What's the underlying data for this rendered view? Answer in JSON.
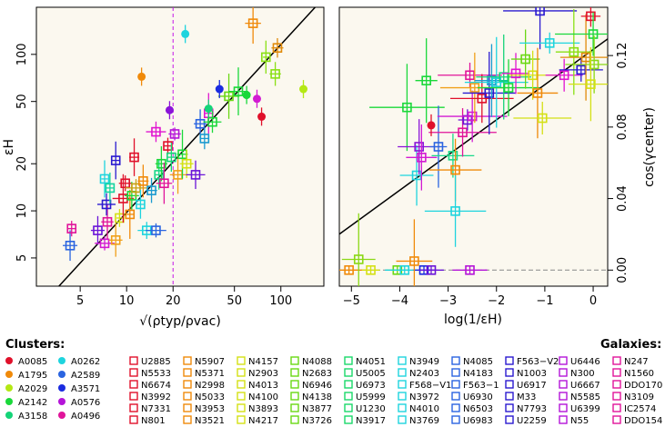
{
  "chart_data": [
    {
      "type": "scatter",
      "log_x": true,
      "log_y": true,
      "xlim": [
        2.6,
        190
      ],
      "ylim": [
        3.3,
        200
      ],
      "xlabel": "√(ρtyp/ρvac)",
      "ylabel": "εH",
      "x_ticks": [
        5,
        10,
        20,
        50,
        100
      ],
      "y_ticks": [
        5,
        10,
        20,
        50,
        100
      ],
      "fit_line": [
        [
          2.6,
          2.3
        ],
        [
          190,
          230
        ]
      ],
      "vline_x": 20,
      "cluster_points": [
        {
          "x": 12.5,
          "y": 72,
          "c": "#f08a0a"
        },
        {
          "x": 24,
          "y": 135,
          "c": "#1ed4de"
        },
        {
          "x": 40,
          "y": 60,
          "c": "#1a2be0"
        },
        {
          "x": 60,
          "y": 55,
          "c": "#1ad83a"
        },
        {
          "x": 70,
          "y": 52,
          "c": "#d21ad2"
        },
        {
          "x": 75,
          "y": 40,
          "c": "#e0102a"
        },
        {
          "x": 140,
          "y": 60,
          "c": "#b4e814"
        },
        {
          "x": 34,
          "y": 45,
          "c": "#14d478"
        },
        {
          "x": 19,
          "y": 44,
          "c": "#8a14d8"
        }
      ],
      "galaxy_points": [
        {
          "x": 4.3,
          "y": 6.0,
          "c": "#2a64e0"
        },
        {
          "x": 4.4,
          "y": 7.7,
          "c": "#e0149a"
        },
        {
          "x": 6.5,
          "y": 7.5,
          "c": "#6a14d8"
        },
        {
          "x": 7.2,
          "y": 6.2,
          "c": "#d21ad2"
        },
        {
          "x": 7.5,
          "y": 8.5,
          "c": "#e0149a"
        },
        {
          "x": 7.4,
          "y": 11,
          "c": "#2a1ad0"
        },
        {
          "x": 7.2,
          "y": 16,
          "c": "#1ed4de"
        },
        {
          "x": 7.8,
          "y": 14,
          "c": "#14d4a0"
        },
        {
          "x": 8.5,
          "y": 21,
          "c": "#2a1ad0"
        },
        {
          "x": 8.5,
          "y": 6.5,
          "c": "#f0a01a"
        },
        {
          "x": 9,
          "y": 9,
          "c": "#d4e014"
        },
        {
          "x": 9.5,
          "y": 12,
          "c": "#e0102a"
        },
        {
          "x": 9.8,
          "y": 15,
          "c": "#e0102a"
        },
        {
          "x": 10.5,
          "y": 9.5,
          "c": "#f08a0a"
        },
        {
          "x": 10.8,
          "y": 12.5,
          "c": "#1ad83a"
        },
        {
          "x": 11.2,
          "y": 22,
          "c": "#e0102a"
        },
        {
          "x": 11.5,
          "y": 14,
          "c": "#c8a014"
        },
        {
          "x": 12.3,
          "y": 11,
          "c": "#1ed4de"
        },
        {
          "x": 12.8,
          "y": 15.5,
          "c": "#f08a0a"
        },
        {
          "x": 13.5,
          "y": 7.5,
          "c": "#1ed4de"
        },
        {
          "x": 14.5,
          "y": 13.5,
          "c": "#1a9ad0"
        },
        {
          "x": 15.5,
          "y": 7.5,
          "c": "#2a64e0"
        },
        {
          "x": 15.5,
          "y": 32,
          "c": "#e014d0"
        },
        {
          "x": 16.2,
          "y": 17,
          "c": "#1ad88a"
        },
        {
          "x": 16.8,
          "y": 20,
          "c": "#1ad83a"
        },
        {
          "x": 17.5,
          "y": 15,
          "c": "#e0149a"
        },
        {
          "x": 18.5,
          "y": 26,
          "c": "#e0102a"
        },
        {
          "x": 19.5,
          "y": 22,
          "c": "#14d478"
        },
        {
          "x": 20.5,
          "y": 31,
          "c": "#b414d8"
        },
        {
          "x": 21.5,
          "y": 17,
          "c": "#f0a01a"
        },
        {
          "x": 23,
          "y": 23,
          "c": "#1ad83a"
        },
        {
          "x": 24.5,
          "y": 20,
          "c": "#d4e014"
        },
        {
          "x": 28,
          "y": 17,
          "c": "#6a14d8"
        },
        {
          "x": 30,
          "y": 36,
          "c": "#2a64e0"
        },
        {
          "x": 32,
          "y": 29,
          "c": "#1a9ad0"
        },
        {
          "x": 34,
          "y": 42,
          "c": "#e014d0"
        },
        {
          "x": 36,
          "y": 37,
          "c": "#1ad83a"
        },
        {
          "x": 46,
          "y": 54,
          "c": "#6ad814"
        },
        {
          "x": 53,
          "y": 58,
          "c": "#1ad83a"
        },
        {
          "x": 66,
          "y": 158,
          "c": "#f08a0a"
        },
        {
          "x": 80,
          "y": 96,
          "c": "#8ae014"
        },
        {
          "x": 92,
          "y": 75,
          "c": "#8ae014"
        },
        {
          "x": 95,
          "y": 110,
          "c": "#e08a0a"
        }
      ]
    },
    {
      "type": "scatter",
      "xlim": [
        -5.25,
        0.3
      ],
      "ylim": [
        -0.009,
        0.147
      ],
      "xlabel": "log(1/εH)",
      "ylabel": "cos(γcenter)",
      "x_ticks": [
        -5,
        -4,
        -3,
        -2,
        -1,
        0
      ],
      "x_ticklabels": [
        "−5",
        "−4",
        "−3",
        "−2",
        "−1",
        "0"
      ],
      "y_ticks": [
        0,
        0.04,
        0.08,
        0.12
      ],
      "y_ticklabels": [
        "0.00",
        "0.04",
        "0.08",
        "0.12"
      ],
      "fit_line": [
        [
          -5.25,
          0.0201
        ],
        [
          0.3,
          0.1293
        ]
      ],
      "zero_dashed": true,
      "cluster_points": [
        {
          "x": -3.35,
          "y": 0.081,
          "c": "#e0102a"
        }
      ],
      "galaxy_points": [
        {
          "x": -5.05,
          "y": 0.0,
          "c": "#f08a0a"
        },
        {
          "x": -4.85,
          "y": 0.006,
          "c": "#8ad814"
        },
        {
          "x": -4.6,
          "y": 0.0,
          "c": "#d4e014"
        },
        {
          "x": -4.05,
          "y": 0.0,
          "c": "#6ad814"
        },
        {
          "x": -3.9,
          "y": 0.0,
          "c": "#1ed4de"
        },
        {
          "x": -3.5,
          "y": 0.0,
          "c": "#1a2be0"
        },
        {
          "x": -3.35,
          "y": 0.0,
          "c": "#6a14d8"
        },
        {
          "x": -3.7,
          "y": 0.005,
          "c": "#f08a0a"
        },
        {
          "x": -2.55,
          "y": 0.0,
          "c": "#b414d8"
        },
        {
          "x": -3.85,
          "y": 0.091,
          "c": "#1ad83a"
        },
        {
          "x": -3.65,
          "y": 0.053,
          "c": "#1ed4de"
        },
        {
          "x": -3.6,
          "y": 0.069,
          "c": "#8a14d8"
        },
        {
          "x": -3.55,
          "y": 0.063,
          "c": "#d21ad2"
        },
        {
          "x": -3.45,
          "y": 0.106,
          "c": "#1ad83a"
        },
        {
          "x": -3.2,
          "y": 0.069,
          "c": "#2a64e0"
        },
        {
          "x": -2.9,
          "y": 0.064,
          "c": "#1ad88a"
        },
        {
          "x": -2.85,
          "y": 0.056,
          "c": "#f08a0a"
        },
        {
          "x": -2.85,
          "y": 0.033,
          "c": "#1ed4de"
        },
        {
          "x": -2.7,
          "y": 0.077,
          "c": "#e0149a"
        },
        {
          "x": -2.6,
          "y": 0.084,
          "c": "#6a14d8"
        },
        {
          "x": -2.5,
          "y": 0.086,
          "c": "#d21ad2"
        },
        {
          "x": -2.55,
          "y": 0.109,
          "c": "#e0149a"
        },
        {
          "x": -2.45,
          "y": 0.102,
          "c": "#f0a01a"
        },
        {
          "x": -2.3,
          "y": 0.096,
          "c": "#e0102a"
        },
        {
          "x": -2.15,
          "y": 0.099,
          "c": "#2a1ad0"
        },
        {
          "x": -2.1,
          "y": 0.106,
          "c": "#1a9ad0"
        },
        {
          "x": -2.0,
          "y": 0.105,
          "c": "#1ed4de"
        },
        {
          "x": -1.85,
          "y": 0.108,
          "c": "#14d478"
        },
        {
          "x": -1.75,
          "y": 0.102,
          "c": "#1ad83a"
        },
        {
          "x": -1.6,
          "y": 0.11,
          "c": "#e014d0"
        },
        {
          "x": -1.4,
          "y": 0.118,
          "c": "#6ad814"
        },
        {
          "x": -1.25,
          "y": 0.109,
          "c": "#d4e014"
        },
        {
          "x": -1.15,
          "y": 0.099,
          "c": "#f08a0a"
        },
        {
          "x": -1.05,
          "y": 0.085,
          "c": "#d4e014"
        },
        {
          "x": -1.1,
          "y": 0.145,
          "c": "#2a1ad0"
        },
        {
          "x": -0.9,
          "y": 0.127,
          "c": "#1ed4de"
        },
        {
          "x": -0.6,
          "y": 0.109,
          "c": "#e014d0"
        },
        {
          "x": -0.4,
          "y": 0.122,
          "c": "#8ae014"
        },
        {
          "x": -0.25,
          "y": 0.112,
          "c": "#2a1ad0"
        },
        {
          "x": -0.15,
          "y": 0.119,
          "c": "#e08a0a"
        },
        {
          "x": -0.05,
          "y": 0.142,
          "c": "#e0102a"
        },
        {
          "x": 0.0,
          "y": 0.132,
          "c": "#1ad83a"
        },
        {
          "x": 0.02,
          "y": 0.115,
          "c": "#8ad814"
        },
        {
          "x": -0.05,
          "y": 0.104,
          "c": "#d4e014"
        }
      ]
    }
  ],
  "legend": {
    "clusters_title": "Clusters:",
    "galaxies_title": "Galaxies:",
    "clusters": [
      {
        "name": "A0085",
        "c": "#e0102a"
      },
      {
        "name": "A1795",
        "c": "#f08a0a"
      },
      {
        "name": "A2029",
        "c": "#b4e814"
      },
      {
        "name": "A2142",
        "c": "#1ad83a"
      },
      {
        "name": "A3158",
        "c": "#14d478"
      },
      {
        "name": "A0262",
        "c": "#1ed4de"
      },
      {
        "name": "A2589",
        "c": "#2a64e0"
      },
      {
        "name": "A3571",
        "c": "#1a2be0"
      },
      {
        "name": "A0576",
        "c": "#b414d8"
      },
      {
        "name": "A0496",
        "c": "#e0149a"
      }
    ],
    "galaxy_columns": [
      {
        "c": "#e0102a",
        "items": [
          "U2885",
          "N5533",
          "N6674",
          "N3992",
          "N7331",
          "N801"
        ]
      },
      {
        "c": "#f08a0a",
        "items": [
          "N5907",
          "N5371",
          "N2998",
          "N5033",
          "N3953",
          "N3521"
        ]
      },
      {
        "c": "#d4e014",
        "items": [
          "N4157",
          "N2903",
          "N4013",
          "N4100",
          "N3893",
          "N4217"
        ]
      },
      {
        "c": "#6ad814",
        "items": [
          "N4088",
          "N2683",
          "N6946",
          "N4138",
          "N3877",
          "N3726"
        ]
      },
      {
        "c": "#1ad86a",
        "items": [
          "N4051",
          "U5005",
          "U6973",
          "U5999",
          "U1230",
          "N3917"
        ]
      },
      {
        "c": "#1ed4de",
        "items": [
          "N3949",
          "N2403",
          "F568−V1",
          "N3972",
          "N4010",
          "N3769"
        ]
      },
      {
        "c": "#2a64e0",
        "items": [
          "N4085",
          "N4183",
          "F563−1",
          "U6930",
          "N6503",
          "U6983"
        ]
      },
      {
        "c": "#2a1ad0",
        "items": [
          "F563−V2",
          "N1003",
          "U6917",
          "M33",
          "N7793",
          "U2259"
        ]
      },
      {
        "c": "#b414d8",
        "items": [
          "U6446",
          "N300",
          "U6667",
          "N5585",
          "U6399",
          "N55"
        ]
      },
      {
        "c": "#e0149a",
        "items": [
          "N247",
          "N1560",
          "DDO170",
          "N3109",
          "IC2574",
          "DDO154"
        ]
      }
    ]
  }
}
